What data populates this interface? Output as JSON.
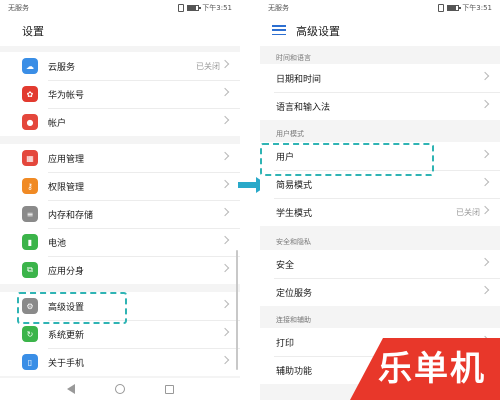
{
  "left_screen": {
    "status_bar": {
      "carrier": "无服务",
      "time": "下午3:51",
      "battery_level": 0.8
    },
    "title": "设置",
    "groups": [
      [
        {
          "label": "云服务",
          "value": "已关闭",
          "icon": "cloud-icon",
          "color": "#3a8ee6"
        },
        {
          "label": "华为帐号",
          "icon": "huawei-logo-icon",
          "color": "#e23a2f"
        },
        {
          "label": "帐户",
          "icon": "account-icon",
          "color": "#e4473c"
        }
      ],
      [
        {
          "label": "应用管理",
          "icon": "app-grid-icon",
          "color": "#e4473c"
        },
        {
          "label": "权限管理",
          "icon": "key-icon",
          "color": "#f08a24"
        },
        {
          "label": "内存和存储",
          "icon": "storage-icon",
          "color": "#8a8a8a"
        },
        {
          "label": "电池",
          "icon": "battery-icon",
          "color": "#3bb44a"
        },
        {
          "label": "应用分身",
          "icon": "app-twin-icon",
          "color": "#3bb44a"
        }
      ],
      [
        {
          "label": "高级设置",
          "icon": "gear-icon",
          "color": "#8a8a8a"
        },
        {
          "label": "系统更新",
          "icon": "update-icon",
          "color": "#3bb44a"
        },
        {
          "label": "关于手机",
          "icon": "phone-icon",
          "color": "#3a8ee6"
        }
      ]
    ]
  },
  "right_screen": {
    "status_bar": {
      "carrier": "无服务",
      "time": "下午3:51",
      "battery_level": 0.8
    },
    "title": "高级设置",
    "sections": [
      {
        "header": "时间和语言",
        "items": [
          {
            "label": "日期和时间"
          },
          {
            "label": "语言和输入法"
          }
        ]
      },
      {
        "header": "用户模式",
        "items": [
          {
            "label": "用户"
          },
          {
            "label": "简易模式"
          },
          {
            "label": "学生模式",
            "value": "已关闭"
          }
        ]
      },
      {
        "header": "安全和隐私",
        "items": [
          {
            "label": "安全"
          },
          {
            "label": "定位服务"
          }
        ]
      },
      {
        "header": "连接和辅助",
        "items": [
          {
            "label": "打印"
          },
          {
            "label": "辅助功能"
          }
        ]
      }
    ]
  },
  "watermark": {
    "text": "乐单机"
  },
  "colors": {
    "highlight": "#2fb4b4",
    "arrow": "#29a9c9",
    "watermark_bg": "#e8372a"
  }
}
